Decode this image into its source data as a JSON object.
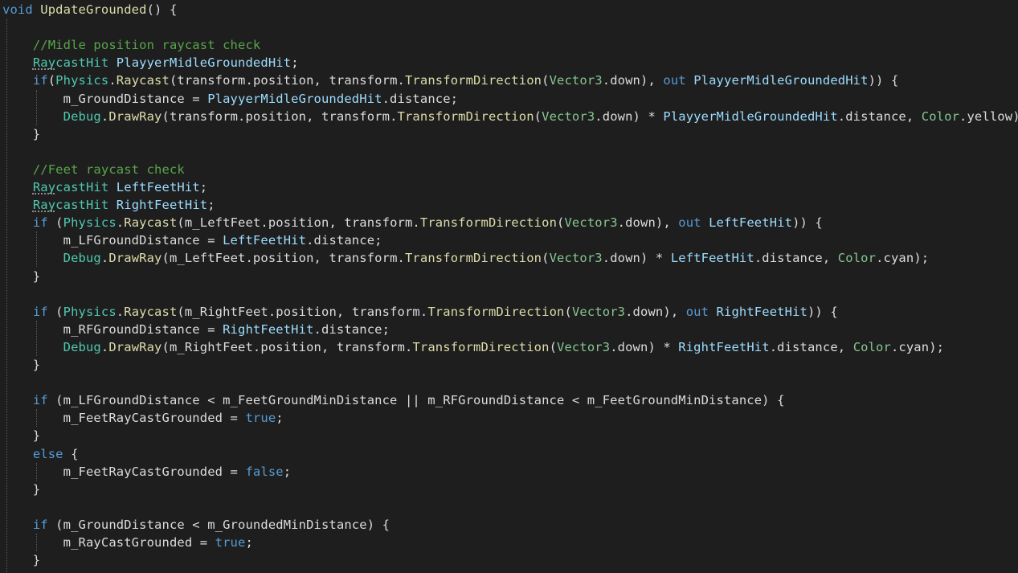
{
  "colors": {
    "background": "#1e1e1e",
    "keyword": "#569cd6",
    "class_type": "#4ec9b0",
    "struct_type": "#86c691",
    "method": "#dcdcaa",
    "comment": "#57a64a",
    "local": "#9cdcfe",
    "default_text": "#dcdcdc"
  },
  "code": {
    "lines": [
      [
        {
          "t": "kw",
          "v": "void"
        },
        {
          "t": "nm",
          "v": " "
        },
        {
          "t": "fn",
          "v": "UpdateGrounded"
        },
        {
          "t": "nm",
          "v": "() {"
        }
      ],
      [],
      [
        {
          "t": "nm",
          "v": "    "
        },
        {
          "t": "cm",
          "v": "//Midle position raycast check"
        }
      ],
      [
        {
          "t": "nm",
          "v": "    "
        },
        {
          "t": "ty",
          "v": "RaycastHit"
        },
        {
          "t": "nm",
          "v": " "
        },
        {
          "t": "lc",
          "v": "PlayyerMidleGroundedHit"
        },
        {
          "t": "nm",
          "v": ";"
        }
      ],
      [
        {
          "t": "nm",
          "v": "    "
        },
        {
          "t": "kw",
          "v": "if"
        },
        {
          "t": "nm",
          "v": "("
        },
        {
          "t": "ty",
          "v": "Physics"
        },
        {
          "t": "nm",
          "v": "."
        },
        {
          "t": "fn",
          "v": "Raycast"
        },
        {
          "t": "nm",
          "v": "(transform.position, transform."
        },
        {
          "t": "fn",
          "v": "TransformDirection"
        },
        {
          "t": "nm",
          "v": "("
        },
        {
          "t": "vt",
          "v": "Vector3"
        },
        {
          "t": "nm",
          "v": ".down), "
        },
        {
          "t": "kw",
          "v": "out"
        },
        {
          "t": "nm",
          "v": " "
        },
        {
          "t": "lc",
          "v": "PlayyerMidleGroundedHit"
        },
        {
          "t": "nm",
          "v": ")) {"
        }
      ],
      [
        {
          "t": "nm",
          "v": "        m_GroundDistance = "
        },
        {
          "t": "lc",
          "v": "PlayyerMidleGroundedHit"
        },
        {
          "t": "nm",
          "v": ".distance;"
        }
      ],
      [
        {
          "t": "nm",
          "v": "        "
        },
        {
          "t": "ty",
          "v": "Debug"
        },
        {
          "t": "nm",
          "v": "."
        },
        {
          "t": "fn",
          "v": "DrawRay"
        },
        {
          "t": "nm",
          "v": "(transform.position, transform."
        },
        {
          "t": "fn",
          "v": "TransformDirection"
        },
        {
          "t": "nm",
          "v": "("
        },
        {
          "t": "vt",
          "v": "Vector3"
        },
        {
          "t": "nm",
          "v": ".down) * "
        },
        {
          "t": "lc",
          "v": "PlayyerMidleGroundedHit"
        },
        {
          "t": "nm",
          "v": ".distance, "
        },
        {
          "t": "vt",
          "v": "Color"
        },
        {
          "t": "nm",
          "v": ".yellow);"
        }
      ],
      [
        {
          "t": "nm",
          "v": "    }"
        }
      ],
      [],
      [
        {
          "t": "nm",
          "v": "    "
        },
        {
          "t": "cm",
          "v": "//Feet raycast check"
        }
      ],
      [
        {
          "t": "nm",
          "v": "    "
        },
        {
          "t": "ty",
          "v": "RaycastHit"
        },
        {
          "t": "nm",
          "v": " "
        },
        {
          "t": "lc",
          "v": "LeftFeetHit"
        },
        {
          "t": "nm",
          "v": ";"
        }
      ],
      [
        {
          "t": "nm",
          "v": "    "
        },
        {
          "t": "ty",
          "v": "RaycastHit"
        },
        {
          "t": "nm",
          "v": " "
        },
        {
          "t": "lc",
          "v": "RightFeetHit"
        },
        {
          "t": "nm",
          "v": ";"
        }
      ],
      [
        {
          "t": "nm",
          "v": "    "
        },
        {
          "t": "kw",
          "v": "if"
        },
        {
          "t": "nm",
          "v": " ("
        },
        {
          "t": "ty",
          "v": "Physics"
        },
        {
          "t": "nm",
          "v": "."
        },
        {
          "t": "fn",
          "v": "Raycast"
        },
        {
          "t": "nm",
          "v": "(m_LeftFeet.position, transform."
        },
        {
          "t": "fn",
          "v": "TransformDirection"
        },
        {
          "t": "nm",
          "v": "("
        },
        {
          "t": "vt",
          "v": "Vector3"
        },
        {
          "t": "nm",
          "v": ".down), "
        },
        {
          "t": "kw",
          "v": "out"
        },
        {
          "t": "nm",
          "v": " "
        },
        {
          "t": "lc",
          "v": "LeftFeetHit"
        },
        {
          "t": "nm",
          "v": ")) {"
        }
      ],
      [
        {
          "t": "nm",
          "v": "        m_LFGroundDistance = "
        },
        {
          "t": "lc",
          "v": "LeftFeetHit"
        },
        {
          "t": "nm",
          "v": ".distance;"
        }
      ],
      [
        {
          "t": "nm",
          "v": "        "
        },
        {
          "t": "ty",
          "v": "Debug"
        },
        {
          "t": "nm",
          "v": "."
        },
        {
          "t": "fn",
          "v": "DrawRay"
        },
        {
          "t": "nm",
          "v": "(m_LeftFeet.position, transform."
        },
        {
          "t": "fn",
          "v": "TransformDirection"
        },
        {
          "t": "nm",
          "v": "("
        },
        {
          "t": "vt",
          "v": "Vector3"
        },
        {
          "t": "nm",
          "v": ".down) * "
        },
        {
          "t": "lc",
          "v": "LeftFeetHit"
        },
        {
          "t": "nm",
          "v": ".distance, "
        },
        {
          "t": "vt",
          "v": "Color"
        },
        {
          "t": "nm",
          "v": ".cyan);"
        }
      ],
      [
        {
          "t": "nm",
          "v": "    }"
        }
      ],
      [],
      [
        {
          "t": "nm",
          "v": "    "
        },
        {
          "t": "kw",
          "v": "if"
        },
        {
          "t": "nm",
          "v": " ("
        },
        {
          "t": "ty",
          "v": "Physics"
        },
        {
          "t": "nm",
          "v": "."
        },
        {
          "t": "fn",
          "v": "Raycast"
        },
        {
          "t": "nm",
          "v": "(m_RightFeet.position, transform."
        },
        {
          "t": "fn",
          "v": "TransformDirection"
        },
        {
          "t": "nm",
          "v": "("
        },
        {
          "t": "vt",
          "v": "Vector3"
        },
        {
          "t": "nm",
          "v": ".down), "
        },
        {
          "t": "kw",
          "v": "out"
        },
        {
          "t": "nm",
          "v": " "
        },
        {
          "t": "lc",
          "v": "RightFeetHit"
        },
        {
          "t": "nm",
          "v": ")) {"
        }
      ],
      [
        {
          "t": "nm",
          "v": "        m_RFGroundDistance = "
        },
        {
          "t": "lc",
          "v": "RightFeetHit"
        },
        {
          "t": "nm",
          "v": ".distance;"
        }
      ],
      [
        {
          "t": "nm",
          "v": "        "
        },
        {
          "t": "ty",
          "v": "Debug"
        },
        {
          "t": "nm",
          "v": "."
        },
        {
          "t": "fn",
          "v": "DrawRay"
        },
        {
          "t": "nm",
          "v": "(m_RightFeet.position, transform."
        },
        {
          "t": "fn",
          "v": "TransformDirection"
        },
        {
          "t": "nm",
          "v": "("
        },
        {
          "t": "vt",
          "v": "Vector3"
        },
        {
          "t": "nm",
          "v": ".down) * "
        },
        {
          "t": "lc",
          "v": "RightFeetHit"
        },
        {
          "t": "nm",
          "v": ".distance, "
        },
        {
          "t": "vt",
          "v": "Color"
        },
        {
          "t": "nm",
          "v": ".cyan);"
        }
      ],
      [
        {
          "t": "nm",
          "v": "    }"
        }
      ],
      [],
      [
        {
          "t": "nm",
          "v": "    "
        },
        {
          "t": "kw",
          "v": "if"
        },
        {
          "t": "nm",
          "v": " (m_LFGroundDistance < m_FeetGroundMinDistance || m_RFGroundDistance < m_FeetGroundMinDistance) {"
        }
      ],
      [
        {
          "t": "nm",
          "v": "        m_FeetRayCastGrounded = "
        },
        {
          "t": "kw",
          "v": "true"
        },
        {
          "t": "nm",
          "v": ";"
        }
      ],
      [
        {
          "t": "nm",
          "v": "    }"
        }
      ],
      [
        {
          "t": "nm",
          "v": "    "
        },
        {
          "t": "kw",
          "v": "else"
        },
        {
          "t": "nm",
          "v": " {"
        }
      ],
      [
        {
          "t": "nm",
          "v": "        m_FeetRayCastGrounded = "
        },
        {
          "t": "kw",
          "v": "false"
        },
        {
          "t": "nm",
          "v": ";"
        }
      ],
      [
        {
          "t": "nm",
          "v": "    }"
        }
      ],
      [],
      [
        {
          "t": "nm",
          "v": "    "
        },
        {
          "t": "kw",
          "v": "if"
        },
        {
          "t": "nm",
          "v": " (m_GroundDistance < m_GroundedMinDistance) {"
        }
      ],
      [
        {
          "t": "nm",
          "v": "        m_RayCastGrounded = "
        },
        {
          "t": "kw",
          "v": "true"
        },
        {
          "t": "nm",
          "v": ";"
        }
      ],
      [
        {
          "t": "nm",
          "v": "    }"
        }
      ]
    ]
  }
}
